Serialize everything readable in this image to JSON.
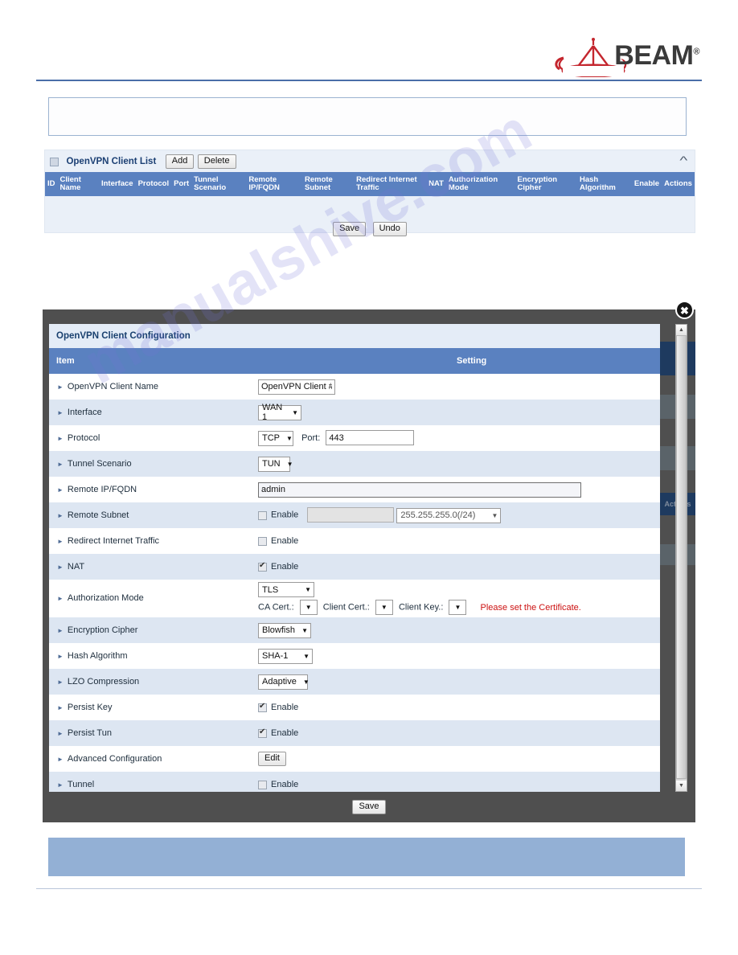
{
  "brand": {
    "name": "BEAM",
    "registered": "®",
    "accent_red": "#c4262e",
    "text_gray": "#3a3a3a"
  },
  "watermark": {
    "text": "manualshive.com"
  },
  "client_list": {
    "title": "OpenVPN Client List",
    "add_label": "Add",
    "delete_label": "Delete",
    "collapse_icon": "chevron-up-icon",
    "columns": [
      "ID",
      "Client Name",
      "Interface",
      "Protocol",
      "Port",
      "Tunnel Scenario",
      "Remote IP/FQDN",
      "Remote Subnet",
      "Redirect Internet Traffic",
      "NAT",
      "Authorization Mode",
      "Encryption Cipher",
      "Hash Algorithm",
      "Enable",
      "Actions"
    ],
    "rows": [],
    "save_label": "Save",
    "undo_label": "Undo",
    "header_bg": "#5a81c0"
  },
  "modal": {
    "title": "OpenVPN Client Configuration",
    "close_icon": "close-icon",
    "col_item": "Item",
    "col_setting": "Setting",
    "save_label": "Save",
    "scrollbar": {
      "up_icon": "caret-up-icon",
      "down_icon": "caret-down-icon"
    },
    "rows": [
      {
        "label": "OpenVPN Client Name",
        "type": "text",
        "value": "OpenVPN Client #"
      },
      {
        "label": "Interface",
        "type": "select",
        "value": "WAN 1"
      },
      {
        "label": "Protocol",
        "type": "select_port",
        "value": "TCP",
        "port_label": "Port:",
        "port_value": "443"
      },
      {
        "label": "Tunnel Scenario",
        "type": "select",
        "value": "TUN"
      },
      {
        "label": "Remote IP/FQDN",
        "type": "text_wide",
        "value": "admin"
      },
      {
        "label": "Remote Subnet",
        "type": "check_subnet",
        "enable_label": "Enable",
        "checked": false,
        "subnet_value": "",
        "mask_value": "255.255.255.0(/24)"
      },
      {
        "label": "Redirect Internet Traffic",
        "type": "check",
        "enable_label": "Enable",
        "checked": false
      },
      {
        "label": "NAT",
        "type": "check",
        "enable_label": "Enable",
        "checked": true
      },
      {
        "label": "Authorization Mode",
        "type": "auth",
        "value": "TLS",
        "ca_label": "CA Cert.:",
        "ca_value": "",
        "client_cert_label": "Client Cert.:",
        "client_cert_value": "",
        "client_key_label": "Client Key.:",
        "client_key_value": "",
        "warning": "Please set the Certificate."
      },
      {
        "label": "Encryption Cipher",
        "type": "select",
        "value": "Blowfish"
      },
      {
        "label": "Hash Algorithm",
        "type": "select",
        "value": "SHA-1"
      },
      {
        "label": "LZO Compression",
        "type": "select",
        "value": "Adaptive"
      },
      {
        "label": "Persist Key",
        "type": "check",
        "enable_label": "Enable",
        "checked": true
      },
      {
        "label": "Persist Tun",
        "type": "check",
        "enable_label": "Enable",
        "checked": true
      },
      {
        "label": "Advanced Configuration",
        "type": "button",
        "value": "Edit"
      },
      {
        "label": "Tunnel",
        "type": "check",
        "enable_label": "Enable",
        "checked": false
      }
    ]
  },
  "background_fragment": {
    "actions_text": "Actions"
  }
}
